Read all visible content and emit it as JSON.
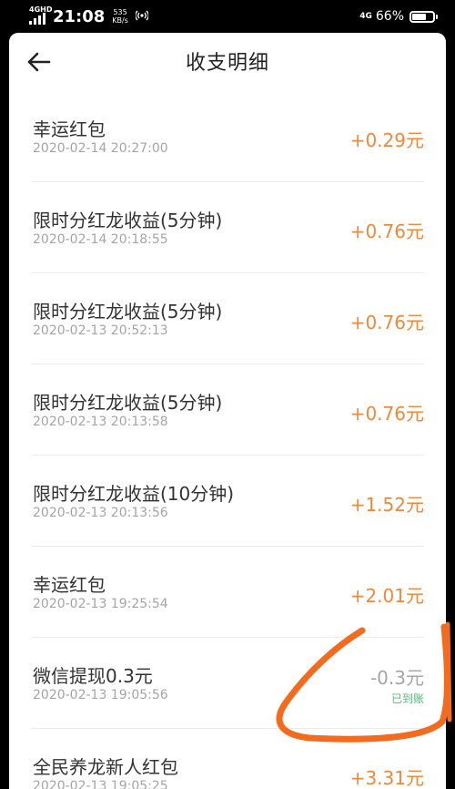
{
  "status_bar": {
    "network_left": "4GHD",
    "time": "21:08",
    "speed_value": "535",
    "speed_unit": "KB/s",
    "network_right": "4G",
    "battery_percent": "66%",
    "battery_level": 0.66
  },
  "header": {
    "title": "收支明细"
  },
  "transactions": [
    {
      "name": "幸运红包",
      "time": "2020-02-14 20:27:00",
      "amount": "+0.29元"
    },
    {
      "name": "限时分红龙收益(5分钟)",
      "time": "2020-02-14 20:18:55",
      "amount": "+0.76元"
    },
    {
      "name": "限时分红龙收益(5分钟)",
      "time": "2020-02-13 20:52:13",
      "amount": "+0.76元"
    },
    {
      "name": "限时分红龙收益(5分钟)",
      "time": "2020-02-13 20:13:58",
      "amount": "+0.76元"
    },
    {
      "name": "限时分红龙收益(10分钟)",
      "time": "2020-02-13 20:13:56",
      "amount": "+1.52元"
    },
    {
      "name": "幸运红包",
      "time": "2020-02-13 19:25:54",
      "amount": "+2.01元"
    },
    {
      "name": "微信提现0.3元",
      "time": "2020-02-13 19:05:56",
      "amount": "-0.3元",
      "status": "已到账"
    },
    {
      "name": "全民养龙新人红包",
      "time": "2020-02-13 19:05:25",
      "amount": "+3.31元"
    }
  ],
  "colors": {
    "income": "#f0883a",
    "expense": "#a5a5a5",
    "status_ok": "#5cb97a",
    "annotation": "#f26b1f"
  },
  "icons": {
    "back": "arrow-left-icon",
    "hotspot": "hotspot-icon",
    "battery": "battery-icon",
    "signal": "signal-icon"
  }
}
